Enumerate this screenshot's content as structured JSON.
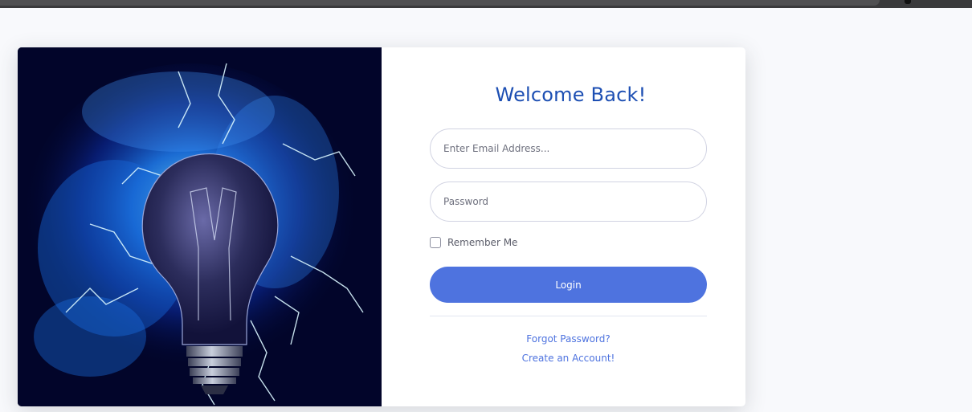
{
  "browser": {
    "icon": "browser-chrome"
  },
  "hero": {
    "icon": "lightbulb-electric-illustration"
  },
  "login": {
    "title": "Welcome Back!",
    "email_placeholder": "Enter Email Address...",
    "password_placeholder": "Password",
    "remember_label": "Remember Me",
    "remember_checked": false,
    "login_button": "Login",
    "forgot_link": "Forgot Password?",
    "create_link": "Create an Account!"
  },
  "colors": {
    "accent": "#4e73df",
    "title": "#1d4fb3",
    "page_background": "#f8f9fc"
  }
}
